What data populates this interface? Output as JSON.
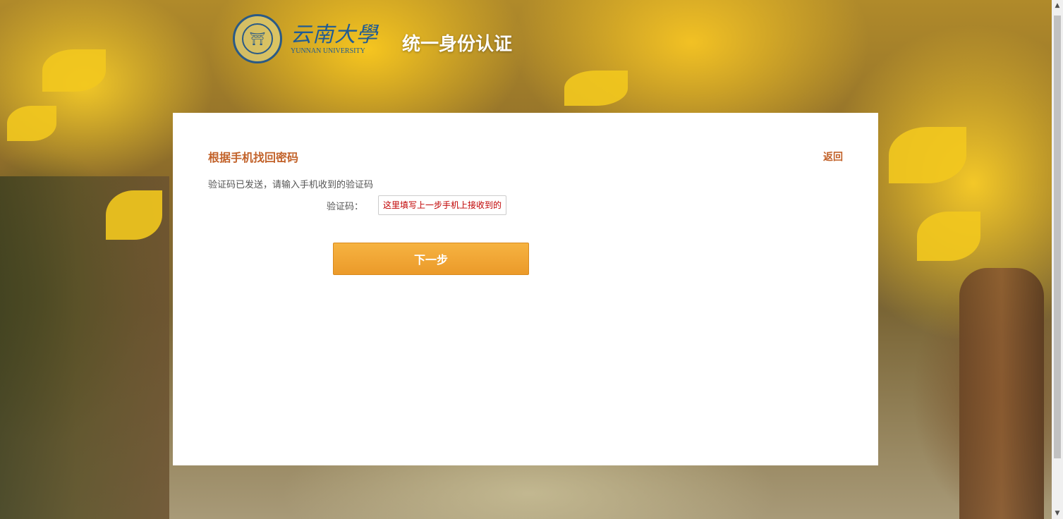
{
  "header": {
    "logo_cn": "云南大學",
    "logo_en": "YUNNAN UNIVERSITY",
    "site_title": "统一身份认证"
  },
  "panel": {
    "title": "根据手机找回密码",
    "back_label": "返回",
    "hint": "验证码已发送，请输入手机收到的验证码",
    "code_label": "验证码：",
    "code_placeholder": "这里填写上一步手机上接收到的六位数字验证码",
    "next_label": "下一步"
  },
  "colors": {
    "accent": "#c2622a",
    "button": "#eb9a2a",
    "placeholder": "#c00000"
  },
  "icons": {
    "logo": "university-seal-icon",
    "scroll_up": "scroll-up-icon",
    "scroll_down": "scroll-down-icon"
  }
}
